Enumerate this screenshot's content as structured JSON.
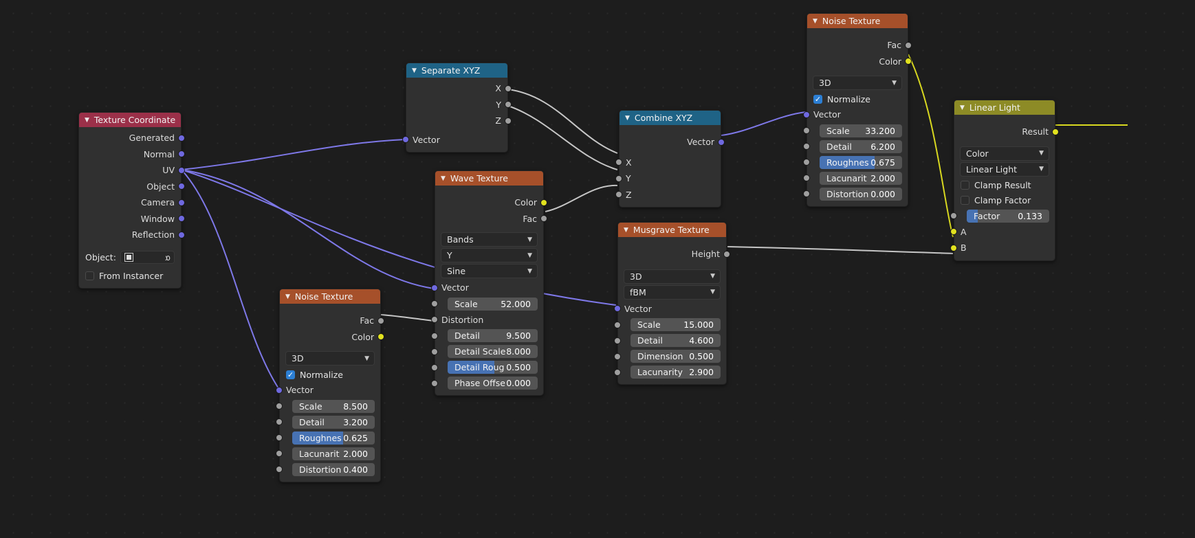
{
  "editor": {
    "name": "shader-node-editor",
    "background": "#1d1d1d"
  },
  "colors": {
    "header_blue": "#1f6386",
    "header_orange": "#a6502a",
    "header_red": "#9b3049",
    "header_olive": "#8d8b26",
    "socket_vector": "#6f69e0",
    "socket_gray": "#9f9f9f",
    "socket_color": "#e2e21f",
    "slider_fill": "#4772b3",
    "wire_vector": "#7e78e8",
    "wire_gray": "#c6c6c6",
    "wire_yellow": "#d8d820"
  },
  "nodes": {
    "texture_coordinate": {
      "title": "Texture Coordinate",
      "outputs": [
        "Generated",
        "Normal",
        "UV",
        "Object",
        "Camera",
        "Window",
        "Reflection"
      ],
      "object_label": "Object:",
      "object_value": "",
      "from_instancer": "From Instancer"
    },
    "separate_xyz": {
      "title": "Separate XYZ",
      "outputs": [
        "X",
        "Y",
        "Z"
      ],
      "inputs": [
        "Vector"
      ]
    },
    "wave_texture": {
      "title": "Wave Texture",
      "outputs": [
        "Color",
        "Fac"
      ],
      "enums": [
        "Bands",
        "Y",
        "Sine"
      ],
      "vector_input": "Vector",
      "distortion_input": "Distortion",
      "values": [
        {
          "name": "Scale",
          "value": "52.000",
          "fill": 0
        },
        {
          "name": "Detail",
          "value": "9.500",
          "fill": 0
        },
        {
          "name": "Detail Scale",
          "value": "8.000",
          "fill": 0
        },
        {
          "name": "Detail Roug",
          "value": "0.500",
          "fill": 52
        },
        {
          "name": "Phase Offse",
          "value": "0.000",
          "fill": 0
        }
      ]
    },
    "combine_xyz": {
      "title": "Combine XYZ",
      "outputs": [
        "Vector"
      ],
      "inputs": [
        "X",
        "Y",
        "Z"
      ]
    },
    "musgrave_texture": {
      "title": "Musgrave Texture",
      "outputs": [
        "Height"
      ],
      "enums": [
        "3D",
        "fBM"
      ],
      "vector_input": "Vector",
      "values": [
        {
          "name": "Scale",
          "value": "15.000",
          "fill": 0
        },
        {
          "name": "Detail",
          "value": "4.600",
          "fill": 0
        },
        {
          "name": "Dimension",
          "value": "0.500",
          "fill": 0
        },
        {
          "name": "Lacunarity",
          "value": "2.900",
          "fill": 0
        }
      ]
    },
    "noise_texture_top": {
      "title": "Noise Texture",
      "outputs": [
        "Fac",
        "Color"
      ],
      "enum": "3D",
      "normalize_label": "Normalize",
      "normalize_checked": true,
      "vector_input": "Vector",
      "values": [
        {
          "name": "Scale",
          "value": "33.200",
          "fill": 0
        },
        {
          "name": "Detail",
          "value": "6.200",
          "fill": 0
        },
        {
          "name": "Roughnes",
          "value": "0.675",
          "fill": 67
        },
        {
          "name": "Lacunarit",
          "value": "2.000",
          "fill": 0
        },
        {
          "name": "Distortion",
          "value": "0.000",
          "fill": 0
        }
      ]
    },
    "noise_texture_bottom": {
      "title": "Noise Texture",
      "outputs": [
        "Fac",
        "Color"
      ],
      "enum": "3D",
      "normalize_label": "Normalize",
      "normalize_checked": true,
      "vector_input": "Vector",
      "values": [
        {
          "name": "Scale",
          "value": "8.500",
          "fill": 0
        },
        {
          "name": "Detail",
          "value": "3.200",
          "fill": 0
        },
        {
          "name": "Roughnes",
          "value": "0.625",
          "fill": 62
        },
        {
          "name": "Lacunarit",
          "value": "2.000",
          "fill": 0
        },
        {
          "name": "Distortion",
          "value": "0.400",
          "fill": 0
        }
      ]
    },
    "linear_light": {
      "title": "Linear Light",
      "outputs": [
        "Result"
      ],
      "enums": [
        "Color",
        "Linear Light"
      ],
      "checkboxes": [
        {
          "label": "Clamp Result",
          "checked": false
        },
        {
          "label": "Clamp Factor",
          "checked": false
        }
      ],
      "factor": {
        "name": "Factor",
        "value": "0.133",
        "fill": 13
      },
      "inputs": [
        "A",
        "B"
      ]
    }
  }
}
